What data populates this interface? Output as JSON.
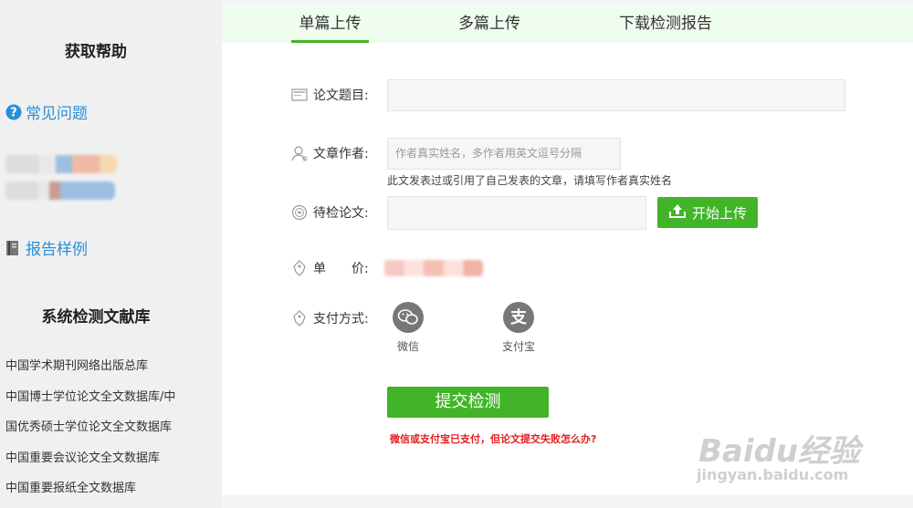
{
  "sidebar": {
    "help_title": "获取帮助",
    "faq_link": "常见问题",
    "report_link": "报告样例",
    "library_title": "系统检测文献库",
    "databases": [
      "中国学术期刊网络出版总库",
      "中国博士学位论文全文数据库/中",
      "国优秀硕士学位论文全文数据库",
      "中国重要会议论文全文数据库",
      "中国重要报纸全文数据库"
    ]
  },
  "tabs": [
    {
      "label": "单篇上传",
      "active": true
    },
    {
      "label": "多篇上传",
      "active": false
    },
    {
      "label": "下载检测报告",
      "active": false
    }
  ],
  "form": {
    "title_label": "论文题目:",
    "title_value": "",
    "author_label": "文章作者:",
    "author_placeholder": "作者真实姓名，多作者用英文逗号分隔",
    "author_hint": "此文发表过或引用了自己发表的文章，请填写作者真实姓名",
    "paper_label": "待检论文:",
    "paper_value": "",
    "upload_button": "开始上传",
    "price_label": "单　　价:",
    "payment_label": "支付方式:",
    "payment_options": [
      "微信",
      "支付宝"
    ],
    "submit_button": "提交检测",
    "failure_link": "微信或支付宝已支付，但论文提交失败怎么办?"
  },
  "watermark": {
    "brand": "Baidu经验",
    "url": "jingyan.baidu.com"
  },
  "colors": {
    "accent_green": "#41b527",
    "link_blue": "#2a8fd8",
    "warning_red": "#e41e1e",
    "tab_bar_bg": "#effdee"
  },
  "icons": [
    "question-circle-icon",
    "book-icon",
    "document-title-icon",
    "user-icon",
    "coin-icon",
    "upload-icon",
    "price-tag-icon",
    "wechat-icon",
    "alipay-icon"
  ]
}
